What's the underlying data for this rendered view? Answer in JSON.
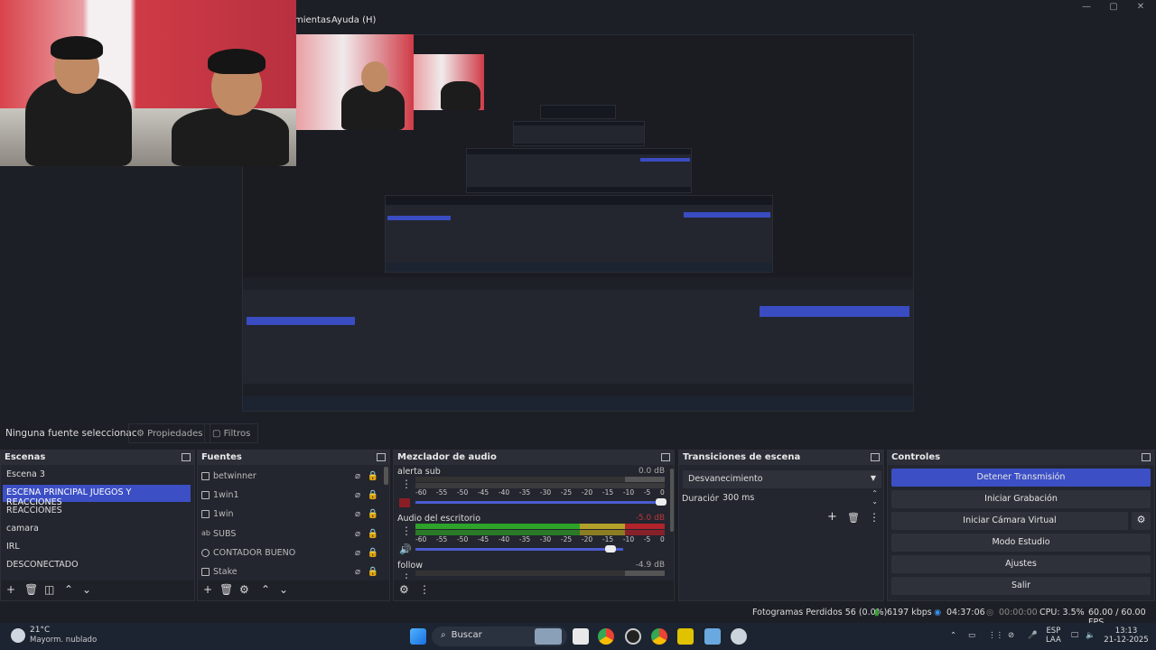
{
  "menubar": {
    "items": [
      "mientas",
      "Ayuda (H)"
    ]
  },
  "source_bar": {
    "no_source": "Ninguna fuente seleccionac",
    "properties": "Propiedades",
    "filters": "Filtros"
  },
  "scenes": {
    "title": "Escenas",
    "items": [
      {
        "label": "Escena 3",
        "selected": false
      },
      {
        "label": "ESCENA PRINCIPAL JUEGOS Y REACCIONES",
        "selected": true
      },
      {
        "label": "REACCIONES",
        "selected": false
      },
      {
        "label": "camara",
        "selected": false
      },
      {
        "label": "IRL",
        "selected": false
      },
      {
        "label": "DESCONECTADO",
        "selected": false
      }
    ]
  },
  "sources": {
    "title": "Fuentes",
    "items": [
      {
        "label": "betwinner",
        "icon": "image-icon"
      },
      {
        "label": "1win1",
        "icon": "image-icon"
      },
      {
        "label": "1win",
        "icon": "image-icon"
      },
      {
        "label": "SUBS",
        "icon": "text-icon"
      },
      {
        "label": "CONTADOR BUENO",
        "icon": "browser-icon"
      },
      {
        "label": "Stake",
        "icon": "image-icon"
      }
    ]
  },
  "mixer": {
    "title": "Mezclador de audio",
    "channels": [
      {
        "name": "alerta sub",
        "db": "0.0 dB",
        "volume": 1.0,
        "muted": true
      },
      {
        "name": "Audio del escritorio",
        "db": "-5.0 dB",
        "volume": 0.82,
        "muted": false
      },
      {
        "name": "follow",
        "db": "-4.9 dB",
        "volume": 0.8,
        "muted": false
      }
    ],
    "ticks": [
      "-60",
      "-55",
      "-50",
      "-45",
      "-40",
      "-35",
      "-30",
      "-25",
      "-20",
      "-15",
      "-10",
      "-5",
      "0"
    ]
  },
  "transitions": {
    "title": "Transiciones de escena",
    "selected": "Desvanecimiento",
    "duration_label": "Duración",
    "duration_value": "300 ms"
  },
  "controls": {
    "title": "Controles",
    "buttons": [
      "Detener Transmisión",
      "Iniciar Grabación",
      "Iniciar Cámara Virtual",
      "Modo Estudio",
      "Ajustes",
      "Salir"
    ]
  },
  "status": {
    "dropped": "Fotogramas Perdidos 56 (0.0%)",
    "bitrate": "6197 kbps",
    "live": "04:37:06",
    "rec": "00:00:00",
    "cpu": "CPU: 3.5%",
    "fps": "60.00 / 60.00 FPS"
  },
  "taskbar": {
    "weather_temp": "21°C",
    "weather_desc": "Mayorm. nublado",
    "search": "Buscar",
    "lang1": "ESP",
    "lang2": "LAA",
    "time": "13:13",
    "date": "21-12-2025"
  },
  "colors": {
    "accent": "#3c4fc5",
    "panel": "#23262e",
    "background": "#1d1f26",
    "meter_green": "#2ea32a",
    "meter_yellow": "#b3a12a",
    "meter_red": "#b2232b"
  }
}
